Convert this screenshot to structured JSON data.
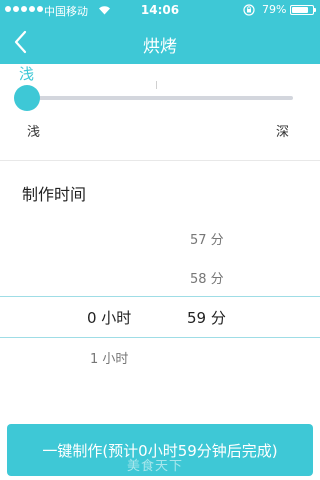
{
  "status_bar": {
    "carrier": "中国移动",
    "time": "14:06",
    "battery_percent": "79%",
    "battery_level": 0.79
  },
  "nav": {
    "title": "烘烤",
    "back_icon": "chevron-left-icon"
  },
  "level": {
    "current_label": "浅",
    "min_label": "浅",
    "max_label": "深",
    "value_fraction": 0.0
  },
  "time_picker": {
    "title": "制作时间",
    "hours": {
      "above": [],
      "selected": "0 小时",
      "below": [
        "1 小时"
      ]
    },
    "minutes": {
      "above": [
        "57 分",
        "58 分"
      ],
      "selected": "59 分",
      "below": []
    }
  },
  "action": {
    "start_label": "一键制作(预计0小时59分钟后完成)"
  },
  "watermark": "美食天下",
  "colors": {
    "accent": "#3ec8d6",
    "track": "#d3d6dd"
  }
}
